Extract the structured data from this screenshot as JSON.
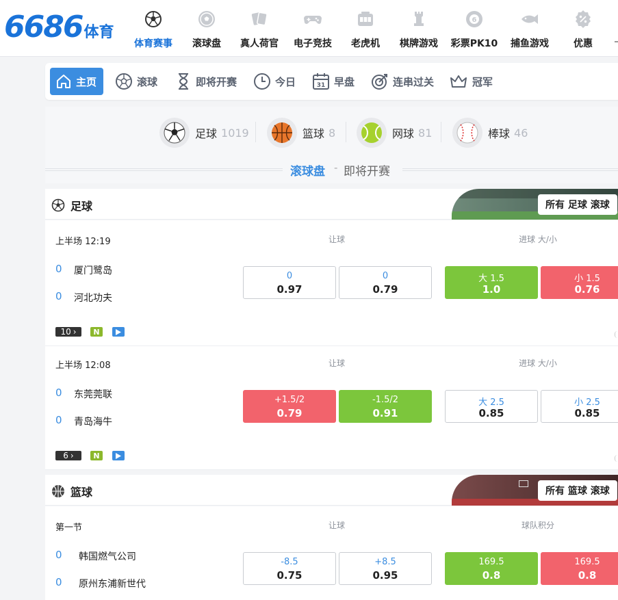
{
  "brand": {
    "logo_num": "6686",
    "logo_cn": "体育"
  },
  "nav": [
    {
      "label": "体育赛事",
      "icon": "soccer-ball-icon",
      "active": true
    },
    {
      "label": "滚球盘",
      "icon": "soccer-ball-outline-icon",
      "active": false
    },
    {
      "label": "真人荷官",
      "icon": "playing-cards-icon",
      "active": false
    },
    {
      "label": "电子竞技",
      "icon": "gamepad-icon",
      "active": false
    },
    {
      "label": "老虎机",
      "icon": "slot-machine-icon",
      "active": false
    },
    {
      "label": "棋牌游戏",
      "icon": "chess-rook-icon",
      "active": false
    },
    {
      "label": "彩票PK10",
      "icon": "lottery-ball-icon",
      "active": false
    },
    {
      "label": "捕鱼游戏",
      "icon": "fish-icon",
      "active": false
    },
    {
      "label": "优惠",
      "icon": "percent-badge-icon",
      "active": false
    }
  ],
  "subnav": [
    {
      "label": "主页",
      "icon": "home-icon",
      "active": true
    },
    {
      "label": "滚球",
      "icon": "soccer-ball-outline-icon"
    },
    {
      "label": "即将开赛",
      "icon": "hourglass-icon"
    },
    {
      "label": "今日",
      "icon": "clock-icon"
    },
    {
      "label": "早盘",
      "icon": "calendar-icon"
    },
    {
      "label": "连串过关",
      "icon": "target-icon"
    },
    {
      "label": "冠军",
      "icon": "crown-icon"
    }
  ],
  "calendar_day": "31",
  "sports": [
    {
      "label": "足球",
      "count": "1019",
      "icon": "soccer-ball-icon"
    },
    {
      "label": "篮球",
      "count": "8",
      "icon": "basketball-icon"
    },
    {
      "label": "网球",
      "count": "81",
      "icon": "tennis-ball-icon"
    },
    {
      "label": "棒球",
      "count": "46",
      "icon": "baseball-icon"
    }
  ],
  "modes": {
    "live": "滚球盘",
    "sep": "-",
    "upcoming": "即将开赛"
  },
  "sections": {
    "football": {
      "title": "足球",
      "all_label": "所有 足球 滚球"
    },
    "basketball": {
      "title": "篮球",
      "all_label": "所有 篮球 滚球"
    }
  },
  "matches": [
    {
      "period": "上半场 12:19",
      "col1": "让球",
      "col2": "进球 大/小",
      "home": {
        "score": "0",
        "name": "厦门鹭岛"
      },
      "away": {
        "score": "0",
        "name": "河北功夫"
      },
      "odds": [
        {
          "line": "0",
          "price": "0.97",
          "style": "plain"
        },
        {
          "line": "0",
          "price": "0.79",
          "style": "plain"
        },
        {
          "line": "大 1.5",
          "price": "1.0",
          "style": "green"
        },
        {
          "line": "小 1.5",
          "price": "0.76",
          "style": "red"
        }
      ],
      "markets": "10"
    },
    {
      "period": "上半场 12:08",
      "col1": "让球",
      "col2": "进球 大/小",
      "home": {
        "score": "0",
        "name": "东莞莞联"
      },
      "away": {
        "score": "0",
        "name": "青岛海牛"
      },
      "odds": [
        {
          "line": "+1.5/2",
          "price": "0.79",
          "style": "red"
        },
        {
          "line": "-1.5/2",
          "price": "0.91",
          "style": "green"
        },
        {
          "line": "大 2.5",
          "price": "0.85",
          "style": "plain"
        },
        {
          "line": "小 2.5",
          "price": "0.85",
          "style": "plain"
        }
      ],
      "markets": "6"
    },
    {
      "period": "第一节",
      "col1": "让球",
      "col2": "球队积分",
      "home": {
        "score": "0",
        "name": "韩国燃气公司"
      },
      "away": {
        "score": "0",
        "name": "原州东浦新世代"
      },
      "odds": [
        {
          "line": "-8.5",
          "price": "0.75",
          "style": "plain"
        },
        {
          "line": "+8.5",
          "price": "0.95",
          "style": "plain"
        },
        {
          "line": "169.5",
          "price": "0.8",
          "style": "green"
        },
        {
          "line": "169.5",
          "price": "0.8",
          "style": "red"
        }
      ]
    }
  ],
  "tags": {
    "n": "N"
  },
  "colors": {
    "primary": "#1a73d9",
    "accent": "#3b8de0",
    "green": "#7cc63c",
    "red": "#f2636c"
  }
}
